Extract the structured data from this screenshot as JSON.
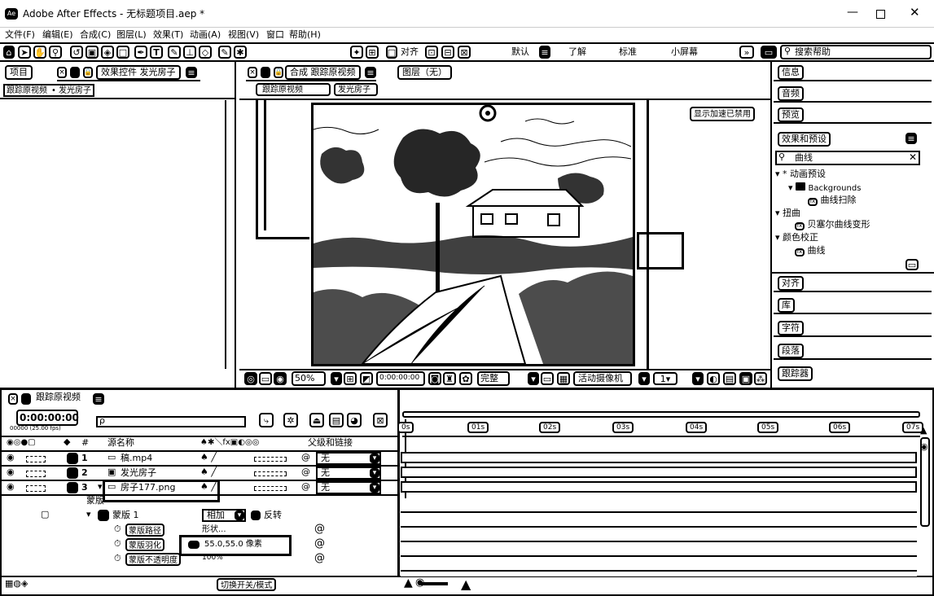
{
  "window": {
    "title": "Adobe After Effects - 无标题项目.aep *"
  },
  "menu": [
    "文件(F)",
    "编辑(E)",
    "合成(C)",
    "图层(L)",
    "效果(T)",
    "动画(A)",
    "视图(V)",
    "窗口",
    "帮助(H)"
  ],
  "toolbar": {
    "align_label": "对齐",
    "workspaces": [
      "默认",
      "了解",
      "标准",
      "小屏幕"
    ],
    "search_help_placeholder": "搜索帮助"
  },
  "left_panel": {
    "tab_project": "项目",
    "tab_effect_controls": "效果控件 发光房子",
    "breadcrumb_comp": "跟踪原视频",
    "breadcrumb_layer": "发光房子"
  },
  "comp_panel": {
    "tab_comp": "合成 跟踪原视频",
    "tab_layer": "图层（无）",
    "sub_tab_comp": "跟踪原视频",
    "sub_tab_layer": "发光房子",
    "badge": "显示加速已禁用",
    "zoom": "50%",
    "timecode": "0:00:00:00",
    "resolution": "完整",
    "camera": "活动摄像机"
  },
  "right_panel": {
    "info": "信息",
    "audio": "音频",
    "preview": "预览",
    "effects_presets": "效果和预设",
    "search_value": "曲线",
    "tree": [
      {
        "label": "* 动画预设",
        "indent": 0
      },
      {
        "label": "Backgrounds",
        "indent": 1
      },
      {
        "label": "曲线扫除",
        "indent": 2
      },
      {
        "label": "扭曲",
        "indent": 0
      },
      {
        "label": "贝塞尔曲线变形",
        "indent": 1
      },
      {
        "label": "颜色校正",
        "indent": 0
      },
      {
        "label": "曲线",
        "indent": 1
      }
    ],
    "align": "对齐",
    "library": "库",
    "character": "字符",
    "paragraph": "段落",
    "tracker": "跟踪器"
  },
  "timeline": {
    "comp_tab": "跟踪原视频",
    "timecode": "0:00:00:00",
    "fps_text": "00000 (25.00 fps)",
    "search_placeholder": "ρ",
    "col_source_name": "源名称",
    "col_parent": "父级和链接",
    "ticks": [
      "0s",
      "01s",
      "02s",
      "03s",
      "04s",
      "05s",
      "06s",
      "07s"
    ],
    "layers": [
      {
        "num": "1",
        "name": "稿.mp4",
        "parent": "无"
      },
      {
        "num": "2",
        "name": "发光房子",
        "parent": "无"
      },
      {
        "num": "3",
        "name": "房子177.png",
        "parent": "无"
      }
    ],
    "mask_group": "蒙版",
    "mask_name": "蒙版 1",
    "mask_mode": "相加",
    "mask_invert": "反转",
    "prop_path": "蒙版路径",
    "prop_path_value": "形状...",
    "prop_feather": "蒙版羽化",
    "prop_feather_value": "55.0,55.0 像素",
    "prop_opacity": "蒙版不透明度",
    "prop_opacity_value": "100%",
    "switch_modes": "切换开关/模式"
  }
}
